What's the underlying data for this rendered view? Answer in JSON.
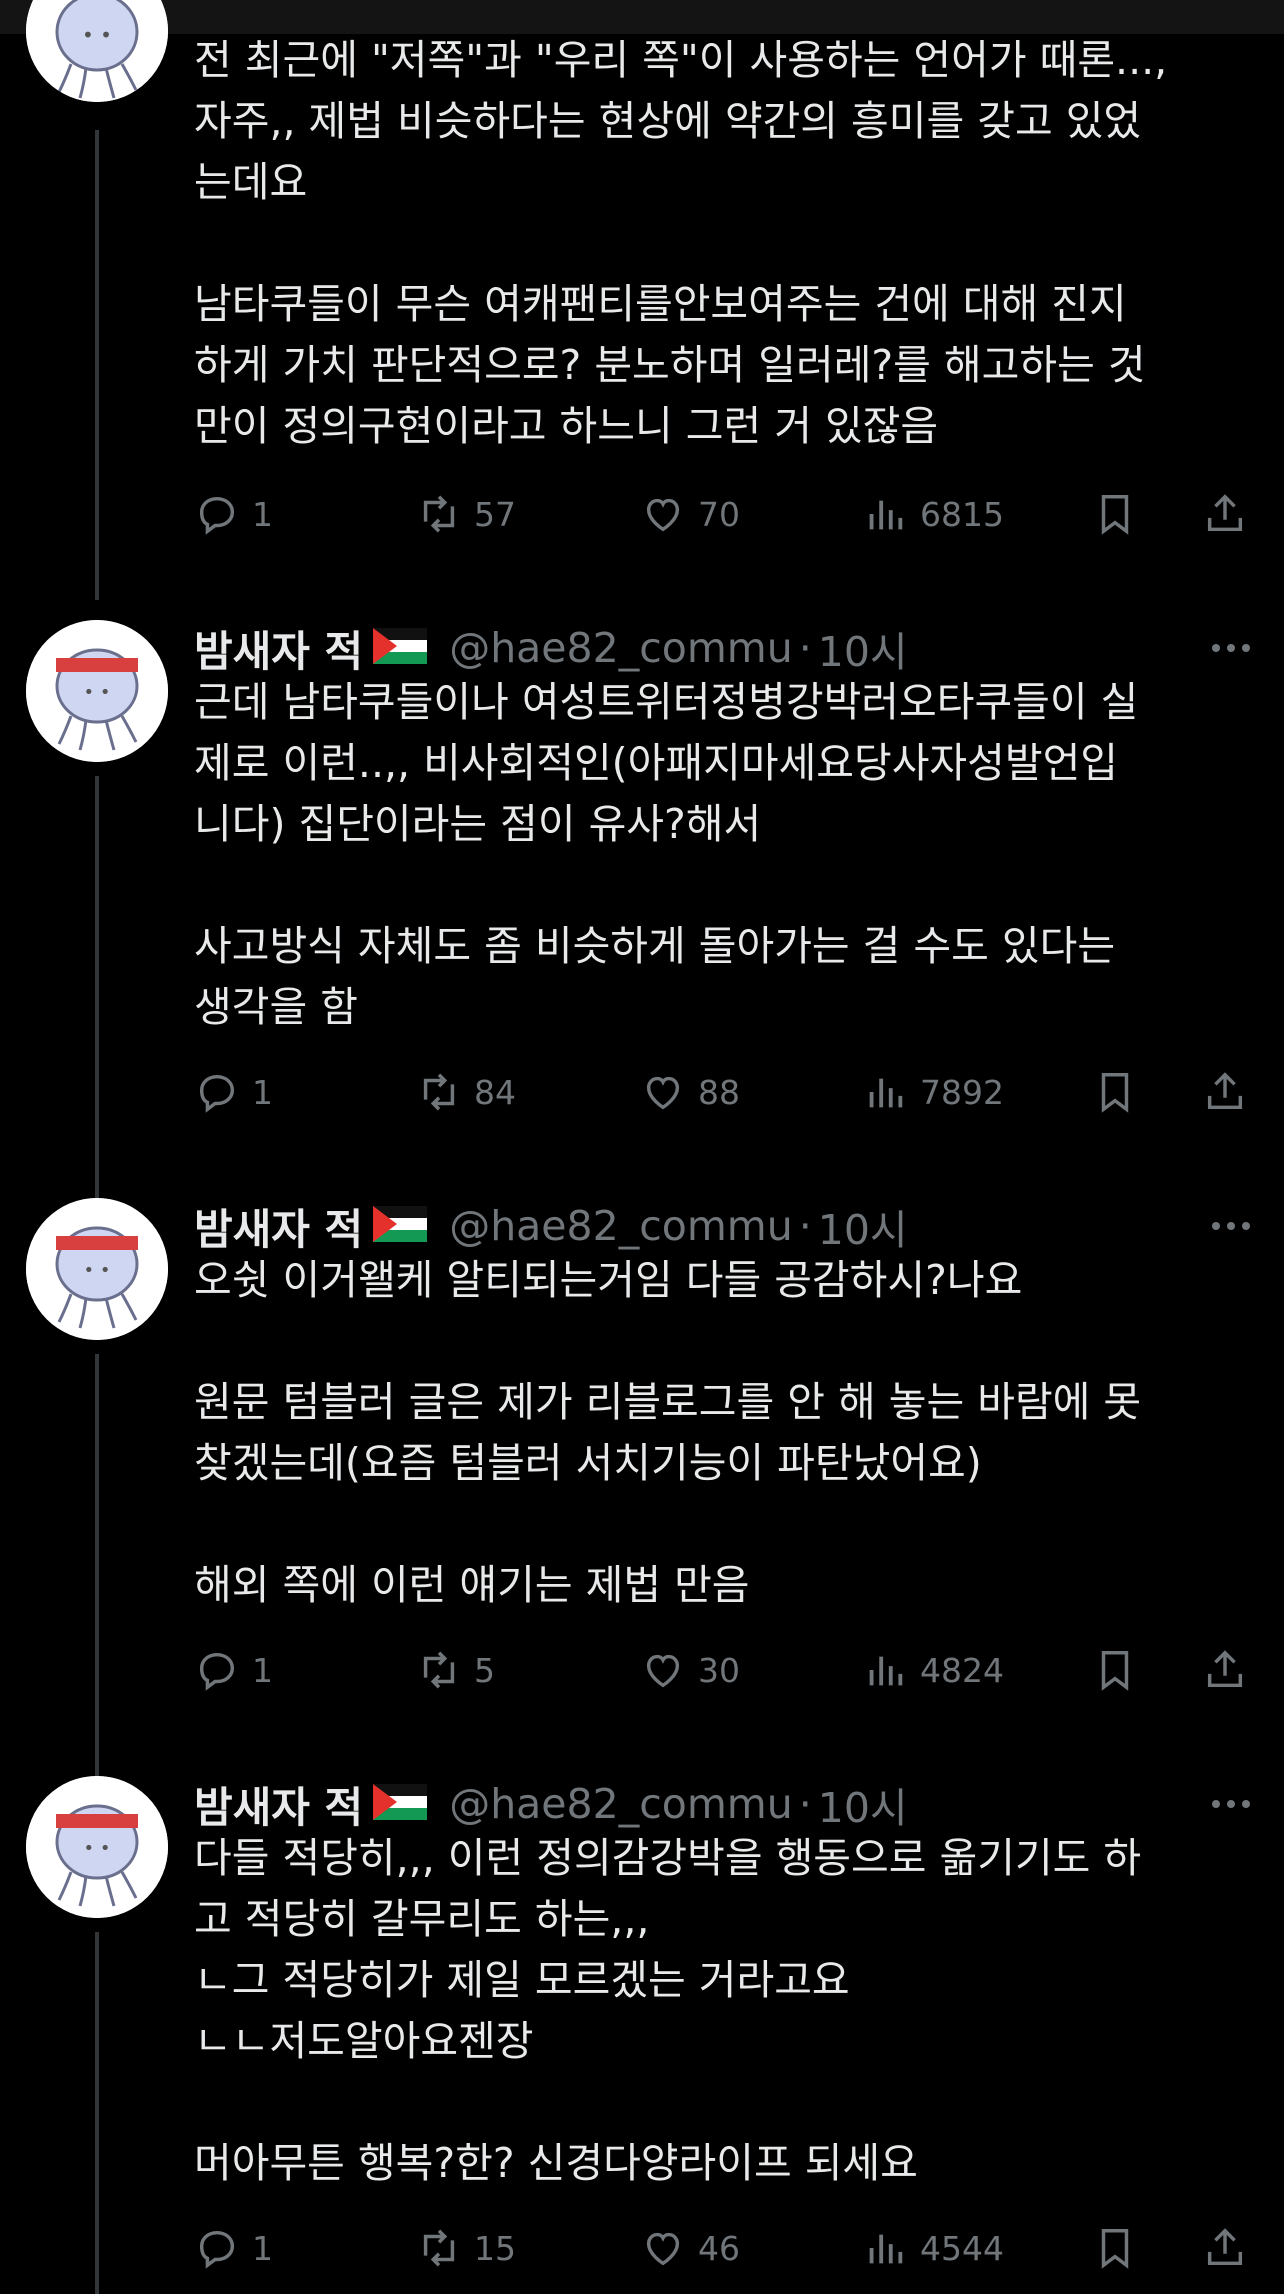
{
  "tweets": [
    {
      "body": [
        "전 최근에 \"저쪽\"과 \"우리 쪽\"이 사용하는 언어가 때론...,",
        "자주,, 제법 비슷하다는 현상에 약간의 흥미를 갖고 있었",
        "는데요",
        "",
        "남타쿠들이 무슨 여캐팬티를안보여주는 건에 대해 진지",
        "하게 가치 판단적으로? 분노하며 일러레?를 해고하는 것",
        "만이 정의구현이라고 하느니 그런 거 있잖음"
      ],
      "replies": "1",
      "retweets": "57",
      "likes": "70",
      "views": "6815"
    },
    {
      "name": "밤새자 적",
      "handle": "@hae82_commu",
      "dot": "·",
      "time": "10시",
      "body": [
        "근데 남타쿠들이나 여성트위터정병강박러오타쿠들이 실",
        "제로 이런..,, 비사회적인(아패지마세요당사자성발언입",
        "니다) 집단이라는 점이 유사?해서",
        "",
        "사고방식 자체도 좀 비슷하게 돌아가는 걸 수도 있다는",
        "생각을 함"
      ],
      "replies": "1",
      "retweets": "84",
      "likes": "88",
      "views": "7892"
    },
    {
      "name": "밤새자 적",
      "handle": "@hae82_commu",
      "dot": "·",
      "time": "10시",
      "body": [
        "오쉿 이거왤케 알티되는거임 다들 공감하시?나요",
        "",
        "원문 텀블러 글은 제가 리블로그를 안 해 놓는 바람에 못",
        "찾겠는데(요즘 텀블러 서치기능이 파탄났어요)",
        "",
        "해외 쪽에 이런 얘기는 제법 만음"
      ],
      "replies": "1",
      "retweets": "5",
      "likes": "30",
      "views": "4824"
    },
    {
      "name": "밤새자 적",
      "handle": "@hae82_commu",
      "dot": "·",
      "time": "10시",
      "body": [
        "다들 적당히,,, 이런 정의감강박을 행동으로 옮기기도 하",
        "고 적당히 갈무리도 하는,,,",
        "ㄴ그 적당히가 제일 모르겠는 거라고요",
        "ㄴㄴ저도알아요젠장",
        "",
        "머아무튼 행복?한? 신경다양라이프 되세요"
      ],
      "replies": "1",
      "retweets": "15",
      "likes": "46",
      "views": "4544"
    }
  ],
  "colors": {
    "background": "#000000",
    "text": "#e7e9ea",
    "muted": "#71767b",
    "thread": "#333639"
  }
}
